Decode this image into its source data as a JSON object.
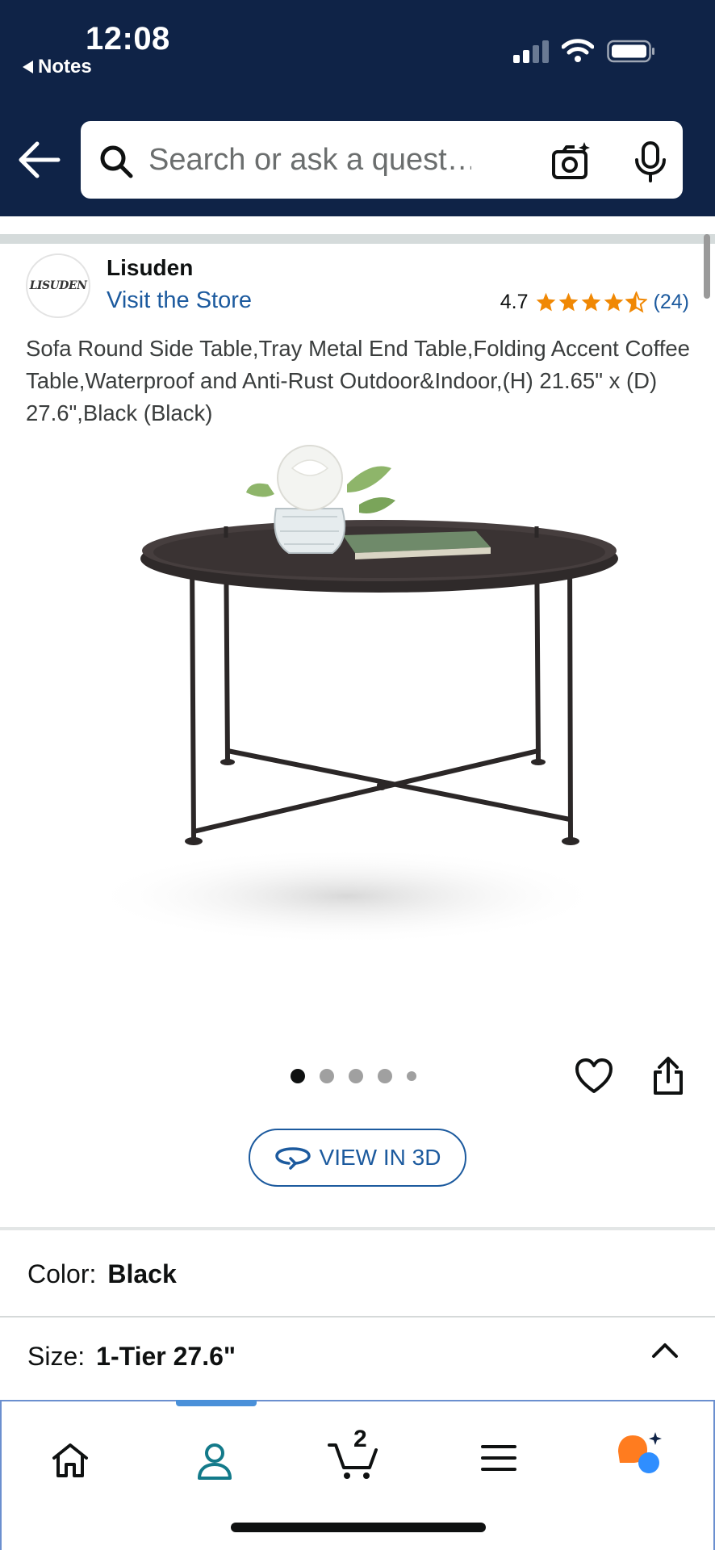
{
  "status_bar": {
    "time": "12:08",
    "back_app": "Notes"
  },
  "header": {
    "search_placeholder": "Search or ask a quest…"
  },
  "brand": {
    "logo_text": "LISUDEN",
    "name": "Lisuden",
    "store_link": "Visit the Store"
  },
  "rating": {
    "value": "4.7",
    "stars": 4.5,
    "count": "(24)"
  },
  "product": {
    "title": "Sofa Round Side Table,Tray Metal End Table,Folding Accent Coffee Table,Waterproof and Anti-Rust Outdoor&Indoor,(H) 21.65\" x (D) 27.6\",Black (Black)",
    "image_count": 5,
    "active_image": 1
  },
  "actions": {
    "view_3d": "VIEW IN 3D"
  },
  "options": {
    "color_label": "Color:",
    "color_value": "Black",
    "size_label": "Size:",
    "size_value": "1-Tier 27.6\""
  },
  "tabbar": {
    "cart_count": "2",
    "active_tab": "account"
  },
  "colors": {
    "header_bg": "#0f2347",
    "link": "#1c5a9e",
    "star": "#f08804",
    "rufus_orange": "#ff7c1f",
    "rufus_blue": "#2f8eff"
  }
}
